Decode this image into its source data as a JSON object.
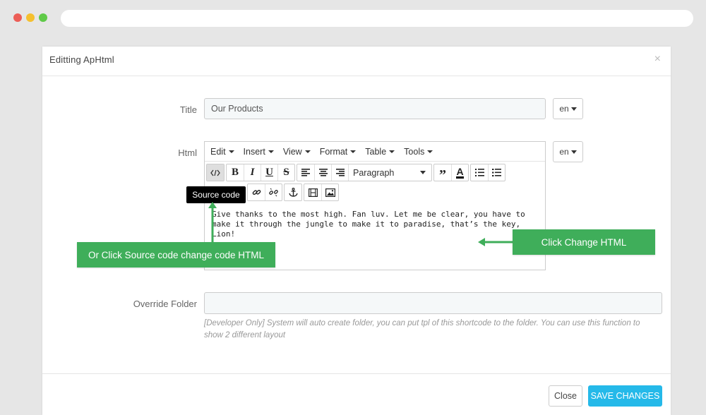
{
  "modal": {
    "title": "Editting ApHtml",
    "close_glyph": "×"
  },
  "form": {
    "title_label": "Title",
    "title_value": "Our Products",
    "title_lang": "en",
    "html_label": "Html",
    "html_lang": "en",
    "override_label": "Override Folder",
    "override_value": "",
    "override_hint": "[Developer Only] System will auto create folder, you can put tpl of this shortcode to the folder. You can use this function to show 2 different layout"
  },
  "editor": {
    "menus": [
      "Edit",
      "Insert",
      "View",
      "Format",
      "Table",
      "Tools"
    ],
    "block_format": "Paragraph",
    "content": "Give thanks to the most high. Fan luv. Let me be clear, you have to make it through the jungle to make it to paradise, that’s the key, Lion!",
    "tooltip": "Source code",
    "toolbar_icons": [
      "source-code-icon",
      "bold-icon",
      "italic-icon",
      "underline-icon",
      "strikethrough-icon",
      "align-left-icon",
      "align-center-icon",
      "align-right-icon",
      "blockquote-icon",
      "text-color-icon",
      "bullet-list-icon",
      "numbered-list-icon",
      "link-icon",
      "unlink-icon",
      "anchor-icon",
      "media-icon",
      "image-icon"
    ]
  },
  "annotations": {
    "source_code_note": "Or Click Source code change code HTML",
    "change_html_note": "Click Change HTML",
    "color": "#3fae5a"
  },
  "footer": {
    "close_label": "Close",
    "save_label": "SAVE CHANGES",
    "save_color": "#25b9e9"
  }
}
